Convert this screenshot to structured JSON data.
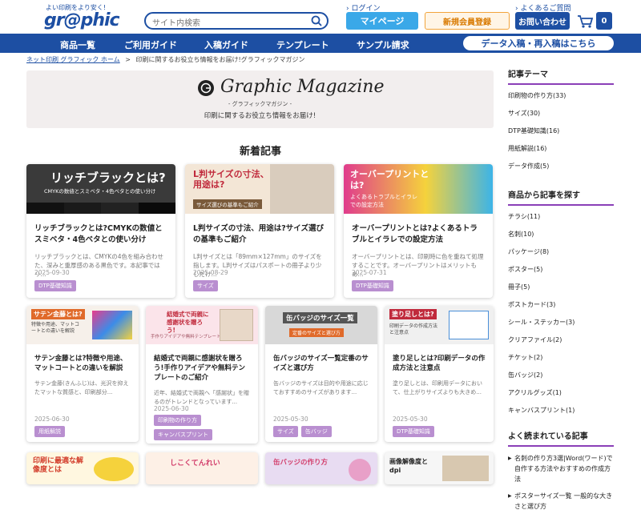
{
  "header": {
    "tagline": "よい印刷をより安く!",
    "logo": "gr@phic",
    "search_placeholder": "サイト内検索",
    "login": "ログイン",
    "faq": "よくあるご質問",
    "mypage": "マイページ",
    "register": "新規会員登録",
    "contact": "お問い合わせ",
    "cart_count": "0"
  },
  "nav": {
    "items": [
      "商品一覧",
      "ご利用ガイド",
      "入稿ガイド",
      "テンプレート",
      "サンプル請求"
    ],
    "cta": "データ入稿・再入稿はこちら"
  },
  "breadcrumb": {
    "home": "ネット印刷 グラフィック ホーム",
    "sep": ">",
    "current": "印刷に関するお役立ち情報をお届け!グラフィックマガジン"
  },
  "hero": {
    "title": "Graphic Magazine",
    "subtitle": "- グラフィックマガジン -",
    "desc": "印刷に関するお役立ち情報をお届け!"
  },
  "section_title": "新着記事",
  "cards": [
    {
      "thumb_text": "リッチブラックとは?",
      "thumb_sub": "CMYKの数値とスミベタ・4色ベタとの使い分け",
      "title": "リッチブラックとは?CMYKの数値とスミベタ・4色ベタとの使い分け",
      "excerpt": "リッチブラックとは、CMYKの4色を組み合わせた、深みと重厚感のある黒色です。本記事ではリ...",
      "date": "2025-09-30",
      "tags": [
        "DTP基礎知識"
      ]
    },
    {
      "thumb_text": "L判サイズの寸法、用途は?",
      "thumb_sub": "サイズ選びの基準もご紹介",
      "title": "L判サイズの寸法、用途は?サイズ選びの基準もご紹介",
      "excerpt": "L判サイズとは「89mm×127mm」のサイズを指します。L判サイズはパスポートの冊子より少しだけ...",
      "date": "2025-08-29",
      "tags": [
        "サイズ"
      ]
    },
    {
      "thumb_text": "オーバープリントとは?",
      "thumb_sub": "よくあるトラブルとイラレでの設定方法",
      "title": "オーバープリントとは?よくあるトラブルとイラレでの設定方法",
      "excerpt": "オーバープリントとは、印刷時に色を重ねて処理することです。オーバープリントはメリットもあ...",
      "date": "2025-07-31",
      "tags": [
        "DTP基礎知識"
      ]
    },
    {
      "thumb_text": "サテン金藤とは?",
      "thumb_sub": "特徴や用途、マットコートとの違いを解説",
      "title": "サテン金藤とは?特徴や用途、マットコートとの違いを解説",
      "excerpt": "サテン金藤(きんふじ)は、光沢を抑えたマットな質感と、印刷部分...",
      "date": "2025-06-30",
      "tags": [
        "用紙解説"
      ]
    },
    {
      "thumb_text": "結婚式で両親に感謝状を贈ろう!",
      "thumb_sub": "手作りアイデアや無料テンプレートのご紹介",
      "title": "結婚式で両親に感謝状を贈ろう!手作りアイデアや無料テンプレートのご紹介",
      "excerpt": "近年、結婚式で両親へ「感謝状」を贈るのがトレンドとなっています...",
      "date": "2025-06-30",
      "tags": [
        "印刷物の作り方",
        "キャンバスプリント"
      ]
    },
    {
      "thumb_text": "缶バッジのサイズ一覧",
      "thumb_sub": "定番のサイズと選び方",
      "title": "缶バッジのサイズ一覧定番のサイズと選び方",
      "excerpt": "缶バッジのサイズは目的や用途に応じておすすめのサイズがあります...",
      "date": "2025-05-30",
      "tags": [
        "サイズ",
        "缶バッジ"
      ]
    },
    {
      "thumb_text": "塗り足しとは?",
      "thumb_sub": "印刷データの作成方法と注意点",
      "title": "塗り足しとは?印刷データの作成方法と注意点",
      "excerpt": "塗り足しとは、印刷用データにおいて、仕上がりサイズよりも大きめ...",
      "date": "2025-05-30",
      "tags": [
        "DTP基礎知識"
      ]
    }
  ],
  "bottom_thumbs": [
    "印刷に最適な解像度とは",
    "しこくてんれい",
    "缶バッジの作り方",
    "画像解像度とdpi"
  ],
  "sidebar": {
    "theme_heading": "記事テーマ",
    "themes": [
      "印刷物の作り方(33)",
      "サイズ(30)",
      "DTP基礎知識(16)",
      "用紙解説(16)",
      "データ作成(5)"
    ],
    "products_heading": "商品から記事を探す",
    "products": [
      "チラシ(11)",
      "名刺(10)",
      "パッケージ(8)",
      "ポスター(5)",
      "冊子(5)",
      "ポストカード(3)",
      "シール・ステッカー(3)",
      "クリアファイル(2)",
      "チケット(2)",
      "缶バッジ(2)",
      "アクリルグッズ(1)",
      "キャンバスプリント(1)"
    ],
    "popular_heading": "よく読まれている記事",
    "popular": [
      "名刺の作り方3選|Word(ワード)で自作する方法やおすすめの作成方法",
      "ポスターサイズ一覧 一般的な大きさと選び方"
    ]
  },
  "colors": {
    "brand": "#1d4fa3",
    "accent": "#8a3fb8",
    "tag": "#b98fd0"
  }
}
